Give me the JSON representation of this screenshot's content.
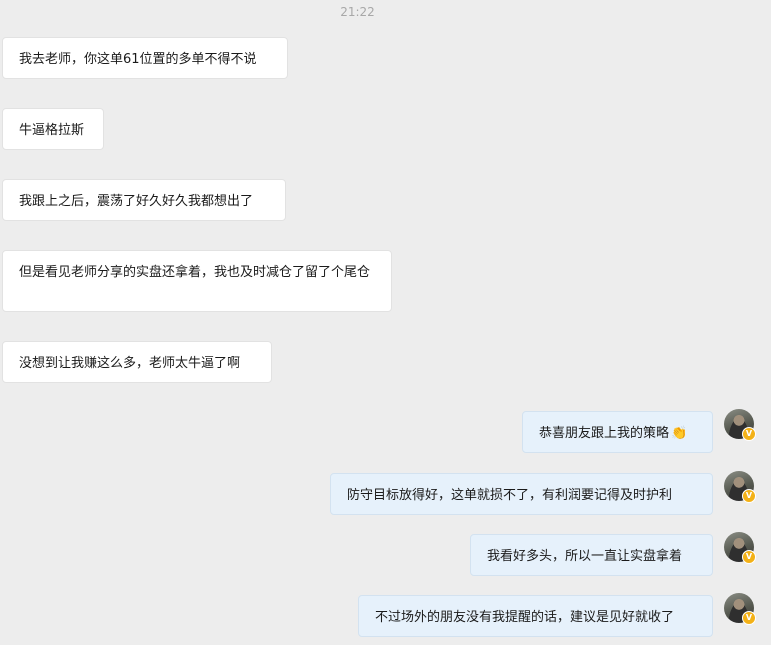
{
  "chat": {
    "timestamp": "21:22",
    "incoming": [
      "我去老师，你这单61位置的多单不得不说",
      "牛逼格拉斯",
      "我跟上之后，震荡了好久好久我都想出了",
      "但是看见老师分享的实盘还拿着，我也及时减仓了留了个尾仓",
      "没想到让我赚这么多，老师太牛逼了啊"
    ],
    "outgoing": [
      "恭喜朋友跟上我的策略",
      "防守目标放得好，这单就损不了，有利润要记得及时护利",
      "我看好多头，所以一直让实盘拿着",
      "不过场外的朋友没有我提醒的话，建议是见好就收了"
    ],
    "emoji_icon": "clapping-hand-icon",
    "avatar_badge": "V"
  }
}
